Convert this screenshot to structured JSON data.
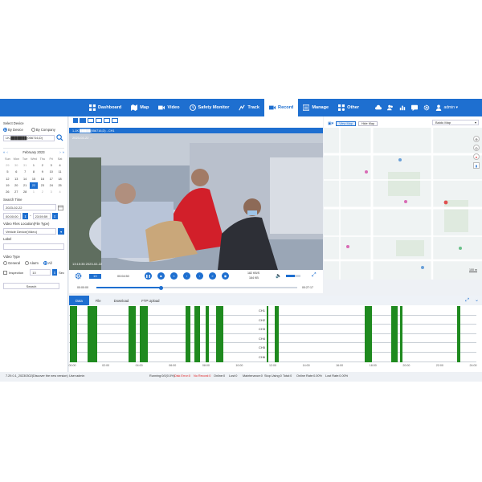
{
  "nav": {
    "items": [
      {
        "label": "Dashboard",
        "icon": "dashboard-icon"
      },
      {
        "label": "Map",
        "icon": "map-icon"
      },
      {
        "label": "Video",
        "icon": "video-icon"
      },
      {
        "label": "Safety Monitor",
        "icon": "shield-icon"
      },
      {
        "label": "Track",
        "icon": "track-icon"
      },
      {
        "label": "Record",
        "icon": "record-icon",
        "active": true
      },
      {
        "label": "Manage",
        "icon": "manage-icon"
      },
      {
        "label": "Other",
        "icon": "grid-icon"
      }
    ],
    "user": "admin ▾",
    "accent": "#1e6fd0"
  },
  "left": {
    "select_device_label": "Select Device",
    "by_device": "By Device",
    "by_company": "By Company",
    "device_value": "LK-███████(056716,D)",
    "calendar": {
      "month": "February 2023",
      "day_names": [
        "Sun",
        "Mon",
        "Tue",
        "Wed",
        "Thu",
        "Fri",
        "Sat"
      ],
      "days": [
        "29",
        "30",
        "31",
        "1",
        "2",
        "3",
        "4",
        "5",
        "6",
        "7",
        "8",
        "9",
        "10",
        "11",
        "12",
        "13",
        "14",
        "15",
        "16",
        "17",
        "18",
        "19",
        "20",
        "21",
        "22",
        "23",
        "24",
        "25",
        "26",
        "27",
        "28",
        "1",
        "2",
        "3",
        "4"
      ],
      "selected": "22"
    },
    "search_time_label": "Search Time",
    "date_value": "2023-02-22",
    "start_time": "00:00:00",
    "end_time": "23:59:59",
    "file_location_label": "Video Files Location(File Type)",
    "file_location_value": "Vehicle Device(Video)",
    "label_label": "Label",
    "video_type_label": "Video Type",
    "type_general": "General",
    "type_alarm": "Alarm",
    "type_all": "All",
    "inspection_label": "Inspection",
    "inspection_value": "10",
    "inspection_unit": "Sec",
    "search_button": "Search"
  },
  "video": {
    "title": "1-1K █████(056716,D) - CH1",
    "overlay_top": "2023-02-22 ...",
    "overlay_bottom": "13:15:35 2023-02-22",
    "speed": "1X",
    "bitrate": "182 KB/S",
    "size": "164 KB",
    "frame": "00:04:50",
    "time_start": "00:00:00",
    "time_end": "00:27:17",
    "progress": 0.32
  },
  "map": {
    "view_map": "View Map",
    "hide_map": "Hide Map",
    "provider": "Baidu Map",
    "scale": "100 m"
  },
  "timeline": {
    "tabs": [
      "Data",
      "File",
      "Download",
      "FTP Upload"
    ],
    "channels": [
      "CH1",
      "CH2",
      "CH3",
      "CH4",
      "CH5",
      "CH6"
    ],
    "axis_labels": [
      "00:00",
      "02:00",
      "04:00",
      "06:00",
      "08:00",
      "10:00",
      "12:00",
      "14:00",
      "16:00",
      "18:00",
      "20:00",
      "22:00",
      "24:00"
    ],
    "segments": [
      [
        0.1,
        0.7
      ],
      [
        1.55,
        2.35
      ],
      [
        4.95,
        5.55
      ],
      [
        5.9,
        6.55
      ],
      [
        9.7,
        10.1
      ],
      [
        10.45,
        10.95
      ],
      [
        11.4,
        11.65
      ],
      [
        12.25,
        12.9
      ],
      [
        16.5,
        16.62
      ],
      [
        17.2,
        17.5
      ],
      [
        24.7,
        25.3
      ],
      [
        26.9,
        27.4
      ],
      [
        27.65,
        27.8
      ],
      [
        32.4,
        32.65
      ]
    ]
  },
  "status": {
    "version": "7.29.0.1_20230302(Discover the new version)",
    "user": "User:admin",
    "running": "Running:0/0(0.0%)",
    "disk_error": "Disk Error:0",
    "no_record": "No Record:0",
    "online": "Online:0",
    "lost": "Lost:0",
    "maintenance": "Maintenance:0",
    "stop_using": "Stop Using:0",
    "total": "Total:0",
    "online_rate": "Online Rate:0.00%",
    "lost_rate": "Lost Rate:0.00%"
  }
}
